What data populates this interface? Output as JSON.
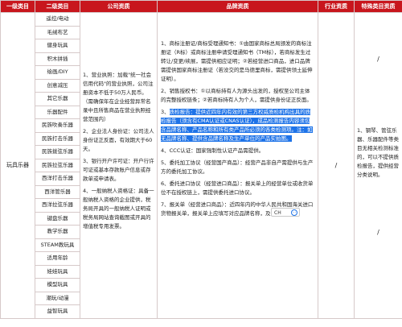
{
  "header": {
    "col1": "一级类目",
    "col2": "二级类目",
    "col3": "公司资质",
    "col4": "品牌资质",
    "col5": "行业资质",
    "col6": "特殊类目资质"
  },
  "category_level1": "玩具乐器",
  "subcategories": [
    "遥控/电动",
    "毛绒布艺",
    "健身玩具",
    "积木拼插",
    "绘画/DIY",
    "创意减压",
    "其它乐器",
    "乐器配件",
    "民族吹奏乐器",
    "民族打击乐器",
    "民族拨弦乐器",
    "民族拉弦乐器",
    "西洋打击乐器",
    "西洋管乐器",
    "西洋拉弦乐器",
    "键盘乐器",
    "教学乐器",
    "STEAM教玩具",
    "适用年龄",
    "娃娃玩具",
    "模型玩具",
    "潮玩/动漫",
    "益智玩具"
  ],
  "company_qualifications": [
    "1、营业执照：加载\"统一社会信用代码\"的营业执照，公司注册资本不低于50万人民币。（需确保年在企业经营异常名录中且所售商品在营业执照经营范围内）",
    "2、企业法人身份证：公司法人身份证正反面，有效期大于60天。",
    "3、银行开户许可证：开户行许可证或基本存款账户信息或存款单或申请表。",
    "4、一般纳税人资格证：具备一般纳税人资格的企业提供，税务局开具的一般纳税人证明或税务局网站查询截图或开具的增值税专用发票。"
  ],
  "product": {
    "p1": "1、商标注册证/商标受理通知书：①由国家商标总局颁发的商标注册证（R标）或商标注册申请受理通知书（TM标），若商标发生过转让/变更/续展，需提供相应证明；②若经营进口商品，进口品牌需提供国家商标注册证（若没交的是马德里商标，需提供领土延伸证明）。",
    "p2": "2、销售授权书：①以商标持有人为源头出发的，授权至公司主体的完整授权链条；②若商标持有人为个人，需提供身份证正反面。",
    "p3_prefix": "3、",
    "p3_title": "质检报告：",
    "p3_body": "提供近四年内有效的第三方权威质检机构出具的质检报告（须含有CMA认证或CNAS认证），成品检测报告内容须包含品牌名称、产品名称和所有类产品所必须的各类检测项。注：如无品牌名称、提供含品牌名称及生产单位的产品实拍图。",
    "p4": "4、CCC认证：国家强制性认证产品需提供。",
    "p5": "5、委托加工协议（经营国产商品）：经营产品非自产需提供与生产方的委托加工协议。",
    "p6": "6、委托进口协议（经营进口商品）：报关单上的经营单位或收货单位不在授权链上，需提供委托进口协议。",
    "p7": "7、报关单（经营进口商品）：近四年内的中华人民共和国海关进口货物报关单，报关单上应填写对应品牌名称，及商品名称。"
  },
  "industry_qualification": "/",
  "special_top": "/",
  "special_rules": "1、钢琴、管弦乐器、乐器配件等类目无相关检测标准的，可以不提供质检报告，提供经营分类说明。",
  "special_bottom": "/",
  "ime": {
    "label": "CH",
    "icon": "ime-menu-icon"
  },
  "colors": {
    "header_bg": "#c8161d",
    "highlight": "#1e73e8",
    "border": "#d6c9c9"
  }
}
